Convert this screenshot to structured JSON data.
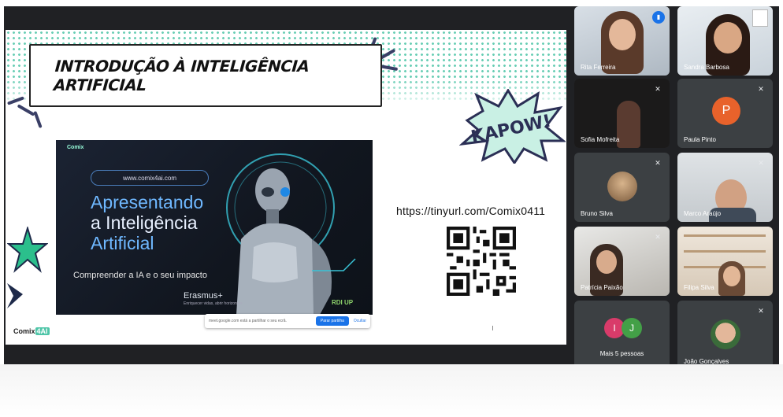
{
  "slide": {
    "title": "INTRODUÇÃO À INTELIGÊNCIA ARTIFICIAL",
    "kapow_text": "KAPOW!",
    "tiny_url": "https://tinyurl.com/Comix0411",
    "inner": {
      "site_url": "www.comix4ai.com",
      "heading_line1": "Apresentando",
      "heading_line2": "a Inteligência",
      "heading_line3": "Artificial",
      "subtitle": "Compreender a IA e o seu impacto",
      "erasmus": "Erasmus+",
      "erasmus_sub": "Enriquecer vidas, abrir horizontes.",
      "rdi_logo": "RDI UP",
      "comix_logo": "Comix"
    },
    "comix_logo_main": "Comix",
    "comix_logo_badge": "4AI"
  },
  "share_bar": {
    "message": "meet.google.com está a partilhar o seu ecrã.",
    "share_button": "Parar partilha",
    "hide_link": "Ocultar"
  },
  "participants": [
    {
      "name": "Rita Ferreira",
      "speaking": true
    },
    {
      "name": "Sandra Barbosa",
      "speaking": false
    },
    {
      "name": "Sofia Mofreita",
      "muted": true
    },
    {
      "name": "Paula Pinto",
      "initial": "P",
      "avatar_color": "#e8622b",
      "muted": true
    },
    {
      "name": "Bruno Silva",
      "muted": true
    },
    {
      "name": "Marco Araújo",
      "muted": true
    },
    {
      "name": "Patrícia Paixão",
      "muted": true
    },
    {
      "name": "Filipa Silva",
      "muted": false
    },
    {
      "name": "João Gonçalves",
      "muted": true
    }
  ],
  "more_tile": {
    "label": "Mais 5 pessoas",
    "initials": [
      "I",
      "J"
    ],
    "colors": [
      "#d93b6a",
      "#43a047"
    ]
  },
  "icons": {
    "muted": "mic-off-icon",
    "speaking": "audio-level-icon"
  }
}
